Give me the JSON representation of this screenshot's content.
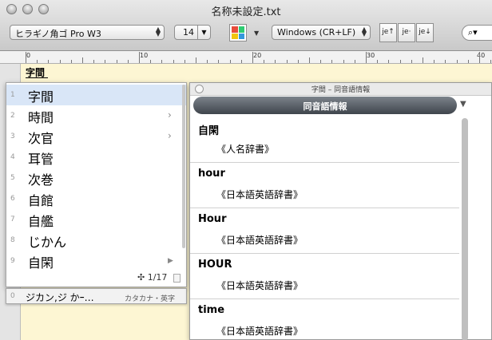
{
  "window": {
    "title": "名称未設定.txt"
  },
  "toolbar": {
    "font": "ヒラギノ角ゴ Pro W3",
    "font_size": "14",
    "line_ending": "Windows (CR+LF)",
    "direction_buttons": [
      "je↑",
      "je·",
      "je↓"
    ],
    "search_icon": "magnifier-icon",
    "color_swatch": [
      "#e74c3c",
      "#2ecc71",
      "#f1c40f",
      "#3498db"
    ]
  },
  "ruler": {
    "labels": [
      "0",
      "10",
      "20",
      "30",
      "40"
    ]
  },
  "editor": {
    "text": "字間"
  },
  "candidates": {
    "items": [
      {
        "num": "1",
        "text": "字間",
        "selected": true,
        "submenu": false
      },
      {
        "num": "2",
        "text": "時間",
        "selected": false,
        "submenu": true
      },
      {
        "num": "3",
        "text": "次官",
        "selected": false,
        "submenu": true
      },
      {
        "num": "4",
        "text": "耳管",
        "selected": false,
        "submenu": false
      },
      {
        "num": "5",
        "text": "次巻",
        "selected": false,
        "submenu": false
      },
      {
        "num": "6",
        "text": "自館",
        "selected": false,
        "submenu": false
      },
      {
        "num": "7",
        "text": "自艦",
        "selected": false,
        "submenu": false
      },
      {
        "num": "8",
        "text": "じかん",
        "selected": false,
        "submenu": false
      },
      {
        "num": "9",
        "text": "自閑",
        "selected": false,
        "submenu": true
      }
    ],
    "page_count": "1/17"
  },
  "ime_bar": {
    "num": "0",
    "text": "ジカン,ジ かｰ…",
    "category": "カタカナ・英字"
  },
  "info_panel": {
    "window_title": "字間 – 同音語情報",
    "header": "同音語情報",
    "entries": [
      {
        "word": "自閑",
        "source": "《人名辞書》"
      },
      {
        "word": "hour",
        "source": "《日本語英語辞書》"
      },
      {
        "word": "Hour",
        "source": "《日本語英語辞書》"
      },
      {
        "word": "HOUR",
        "source": "《日本語英語辞書》"
      },
      {
        "word": "time",
        "source": "《日本語英語辞書》"
      }
    ]
  }
}
